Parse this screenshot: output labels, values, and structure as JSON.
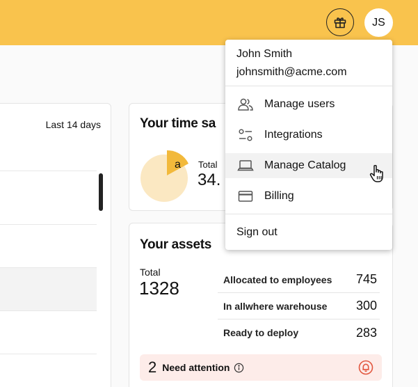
{
  "header": {
    "avatar_initials": "JS",
    "gift_icon": "gift-icon",
    "background_color": "#f9c34d"
  },
  "activity_card": {
    "range_label": "Last 14 days"
  },
  "time_saved_card": {
    "title": "Your time sa",
    "pie_letter": "a",
    "total_label": "Total",
    "total_value": "34.",
    "pie_colors": {
      "highlight": "#f2b93b",
      "base": "#fbe8c2"
    }
  },
  "assets_card": {
    "title": "Your assets",
    "total_label": "Total",
    "total_value": "1328",
    "rows": [
      {
        "label": "Allocated to employees",
        "value": "745"
      },
      {
        "label": "In allwhere warehouse",
        "value": "300"
      },
      {
        "label": "Ready to deploy",
        "value": "283"
      }
    ],
    "attention": {
      "count": "2",
      "label": "Need attention",
      "info_icon": "info-icon",
      "bell_icon": "bell-icon",
      "color": "#e2573f"
    }
  },
  "user_menu": {
    "name": "John Smith",
    "email": "johnsmith@acme.com",
    "items": [
      {
        "label": "Manage users",
        "icon": "users-icon"
      },
      {
        "label": "Integrations",
        "icon": "sliders-icon"
      },
      {
        "label": "Manage Catalog",
        "icon": "laptop-icon"
      },
      {
        "label": "Billing",
        "icon": "credit-card-icon"
      }
    ],
    "hovered_item": "Manage Catalog",
    "sign_out_label": "Sign out"
  }
}
